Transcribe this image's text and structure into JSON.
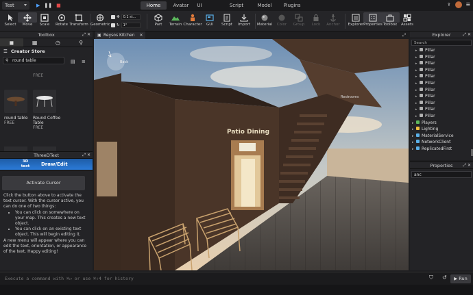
{
  "topbar": {
    "project": "Test",
    "tabs": [
      "Home",
      "Avatar",
      "UI",
      "Script",
      "Model",
      "Plugins"
    ],
    "active_tab": "Home"
  },
  "ribbon": {
    "tools": [
      {
        "label": "Select",
        "icon": "cursor-icon"
      },
      {
        "label": "Move",
        "icon": "move-icon"
      },
      {
        "label": "Scale",
        "icon": "scale-icon"
      },
      {
        "label": "Rotate",
        "icon": "rotate-icon"
      },
      {
        "label": "Transform",
        "icon": "transform-icon"
      },
      {
        "label": "Geometric",
        "icon": "geometric-icon"
      }
    ],
    "snap": {
      "move_value": "0.1 st...",
      "rotate_value": "1°"
    },
    "insert": [
      {
        "label": "Part",
        "icon": "part-icon"
      },
      {
        "label": "Terrain",
        "icon": "terrain-icon"
      },
      {
        "label": "Character",
        "icon": "character-icon"
      },
      {
        "label": "GUI",
        "icon": "gui-icon"
      },
      {
        "label": "Script",
        "icon": "script-icon"
      },
      {
        "label": "Import",
        "icon": "import-icon"
      }
    ],
    "arrange": [
      {
        "label": "Material",
        "icon": "material-icon"
      },
      {
        "label": "Color",
        "icon": "color-icon"
      },
      {
        "label": "Group",
        "icon": "group-icon"
      },
      {
        "label": "Lock",
        "icon": "lock-icon"
      },
      {
        "label": "Anchor",
        "icon": "anchor-icon"
      }
    ],
    "windows": [
      {
        "label": "Explorer",
        "icon": "explorer-icon"
      },
      {
        "label": "Properties",
        "icon": "properties-icon"
      },
      {
        "label": "Toolbox",
        "icon": "toolbox-icon"
      },
      {
        "label": "Assets",
        "icon": "assets-icon"
      }
    ]
  },
  "toolbox": {
    "title": "Toolbox",
    "store": "Creator Store",
    "search_value": "round table",
    "partial_label": "FREE",
    "items": [
      {
        "name": "round table",
        "price": "FREE"
      },
      {
        "name": "Round Coffee Table",
        "price": "FREE"
      }
    ]
  },
  "threedtext": {
    "title": "ThreeDText",
    "logo": "3D text",
    "mode": "Draw/Edit",
    "button": "Activate Cursor",
    "intro": "Click the button above to activate the text cursor. With the cursor active, you can do one of two things:",
    "bullets": [
      "You can click on somewhere on your map. This creates a new text object.",
      "You can click on an existing text object. This will begin editing it."
    ],
    "outro": "A new menu will appear where you can edit the text, orientation, or appearance of the text. Happy editing!"
  },
  "viewport": {
    "tab": "Reysos Kitchen",
    "nav": "Back",
    "sign": "Patio Dining",
    "sign2": "Restrooms"
  },
  "explorer": {
    "title": "Explorer",
    "search_placeholder": "Search",
    "items": [
      {
        "label": "Pillar",
        "depth": 2
      },
      {
        "label": "Pillar",
        "depth": 2
      },
      {
        "label": "Pillar",
        "depth": 2
      },
      {
        "label": "Pillar",
        "depth": 2
      },
      {
        "label": "Pillar",
        "depth": 2
      },
      {
        "label": "Pillar",
        "depth": 2
      },
      {
        "label": "Pillar",
        "depth": 2
      },
      {
        "label": "Pillar",
        "depth": 2
      },
      {
        "label": "Pillar",
        "depth": 2
      },
      {
        "label": "Pillar",
        "depth": 2
      },
      {
        "label": "Pillar",
        "depth": 2
      },
      {
        "label": "Players",
        "depth": 0
      },
      {
        "label": "Lighting",
        "depth": 0
      },
      {
        "label": "MaterialService",
        "depth": 0
      },
      {
        "label": "NetworkClient",
        "depth": 0
      },
      {
        "label": "ReplicatedFirst",
        "depth": 0
      }
    ]
  },
  "properties": {
    "title": "Properties",
    "filter_value": "anc"
  },
  "command": {
    "placeholder": "Execute a command with ⌘↵ or use ⌘⇧4 for history",
    "run": "Run"
  },
  "colors": {
    "accent": "#2b7bd8",
    "bg": "#232326"
  }
}
